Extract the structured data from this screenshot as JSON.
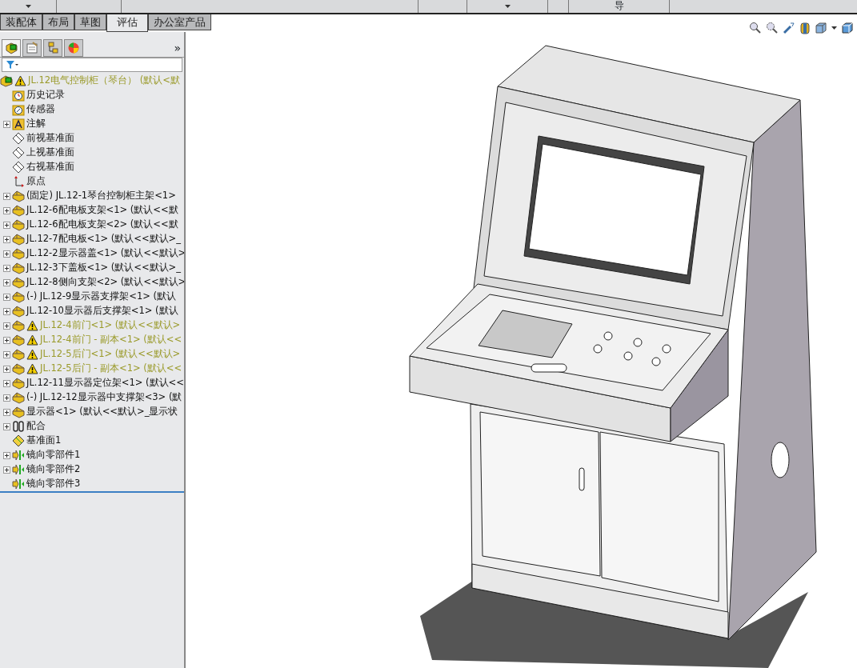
{
  "command_manager": {
    "fragment": "导"
  },
  "tabs": [
    {
      "label": "装配体",
      "selected": false
    },
    {
      "label": "布局",
      "selected": false
    },
    {
      "label": "草图",
      "selected": false
    },
    {
      "label": "评估",
      "selected": true
    },
    {
      "label": "办公室产品",
      "selected": false
    }
  ],
  "panel_tabs": [
    {
      "kind": "tree",
      "selected": true
    },
    {
      "kind": "property",
      "selected": false
    },
    {
      "kind": "config",
      "selected": false
    },
    {
      "kind": "appearance",
      "selected": false
    }
  ],
  "panel_more": "»",
  "tree": [
    {
      "kind": "root",
      "label": "JL.12电气控制柜（琴台） (默认<默",
      "warning": true,
      "expandable": false
    },
    {
      "kind": "history",
      "label": "历史记录",
      "warning": false,
      "expandable": false
    },
    {
      "kind": "sensor",
      "label": "传感器",
      "warning": false,
      "expandable": false
    },
    {
      "kind": "annotation",
      "label": "注解",
      "warning": false,
      "expandable": true
    },
    {
      "kind": "plane",
      "label": "前视基准面",
      "warning": false,
      "expandable": false
    },
    {
      "kind": "plane",
      "label": "上视基准面",
      "warning": false,
      "expandable": false
    },
    {
      "kind": "plane",
      "label": "右视基准面",
      "warning": false,
      "expandable": false
    },
    {
      "kind": "origin",
      "label": "原点",
      "warning": false,
      "expandable": false
    },
    {
      "kind": "part",
      "label": "(固定) JL.12-1琴台控制柜主架<1>",
      "warning": false,
      "expandable": true
    },
    {
      "kind": "part",
      "label": "JL.12-6配电板支架<1> (默认<<默",
      "warning": false,
      "expandable": true
    },
    {
      "kind": "part",
      "label": "JL.12-6配电板支架<2> (默认<<默",
      "warning": false,
      "expandable": true
    },
    {
      "kind": "part",
      "label": "JL.12-7配电板<1> (默认<<默认>_",
      "warning": false,
      "expandable": true
    },
    {
      "kind": "part",
      "label": "JL.12-2显示器盖<1> (默认<<默认>",
      "warning": false,
      "expandable": true
    },
    {
      "kind": "part",
      "label": "JL.12-3下盖板<1> (默认<<默认>_",
      "warning": false,
      "expandable": true
    },
    {
      "kind": "part",
      "label": "JL.12-8侧向支架<2> (默认<<默认>",
      "warning": false,
      "expandable": true
    },
    {
      "kind": "part",
      "label": "(-) JL.12-9显示器支撑架<1> (默认",
      "warning": false,
      "expandable": true
    },
    {
      "kind": "part",
      "label": "JL.12-10显示器后支撑架<1> (默认",
      "warning": false,
      "expandable": true
    },
    {
      "kind": "part",
      "label": "JL.12-4前门<1> (默认<<默认>",
      "warning": true,
      "expandable": true
    },
    {
      "kind": "part",
      "label": "JL.12-4前门 - 副本<1> (默认<<",
      "warning": true,
      "expandable": true
    },
    {
      "kind": "part",
      "label": "JL.12-5后门<1> (默认<<默认>",
      "warning": true,
      "expandable": true
    },
    {
      "kind": "part",
      "label": "JL.12-5后门 - 副本<1> (默认<<",
      "warning": true,
      "expandable": true
    },
    {
      "kind": "part",
      "label": "JL.12-11显示器定位架<1> (默认<<",
      "warning": false,
      "expandable": true
    },
    {
      "kind": "part",
      "label": "(-) JL.12-12显示器中支撑架<3> (默",
      "warning": false,
      "expandable": true
    },
    {
      "kind": "part",
      "label": "显示器<1> (默认<<默认>_显示状",
      "warning": false,
      "expandable": true
    },
    {
      "kind": "mate",
      "label": "配合",
      "warning": false,
      "expandable": true
    },
    {
      "kind": "datum",
      "label": "基准面1",
      "warning": false,
      "expandable": false
    },
    {
      "kind": "mirror",
      "label": "镜向零部件1",
      "warning": false,
      "expandable": true
    },
    {
      "kind": "mirror",
      "label": "镜向零部件2",
      "warning": false,
      "expandable": true
    },
    {
      "kind": "mirror",
      "label": "镜向零部件3",
      "warning": false,
      "expandable": false
    }
  ]
}
